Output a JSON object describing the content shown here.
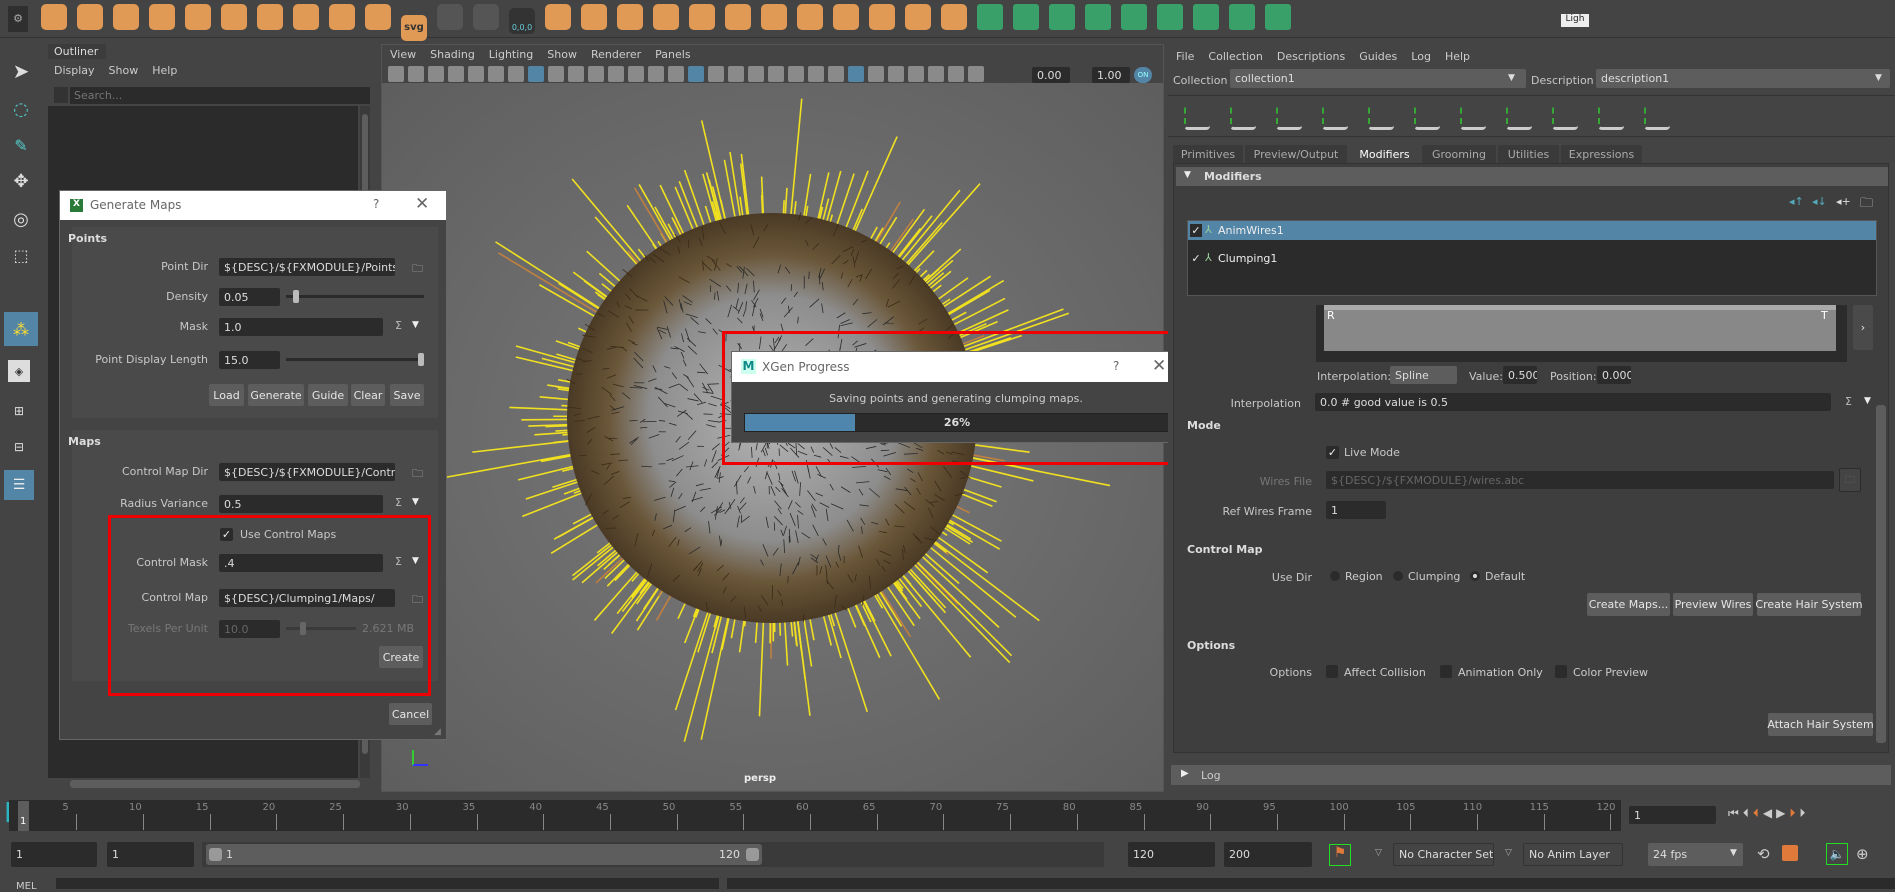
{
  "shelf": {
    "icons": [
      "poly-sphere-icon",
      "poly-cube-icon",
      "poly-cylinder-icon",
      "poly-cone-icon",
      "poly-torus-icon",
      "poly-plane-icon",
      "poly-disc-icon",
      "platonic-icon",
      "super-shape-icon",
      "type-icon",
      "svg-icon",
      "measure-icon",
      "locator-icon",
      "world-origin-icon",
      "sculpt-icon",
      "combine-icon",
      "separate-icon",
      "smooth-icon",
      "extrude-icon",
      "bridge-icon",
      "append-icon",
      "multi-cut-icon",
      "bevel-icon",
      "edge-loop-icon",
      "uv-icon",
      "mirror-icon",
      "xgen-create-icon",
      "xgen-guide-icon",
      "xgen-groom-icon",
      "xgen-collection-icon",
      "xgen-modifier-icon",
      "xgen-preview-icon",
      "xgen-map-icon",
      "xgen-export-icon",
      "xgen-tool-icon"
    ],
    "svg_label": "svg",
    "origin_label": "0,0,0",
    "light_tab": "Ligh"
  },
  "outliner": {
    "tab": "Outliner",
    "menu": [
      "Display",
      "Show",
      "Help"
    ],
    "search_placeholder": "Search..."
  },
  "viewport": {
    "menu": [
      "View",
      "Shading",
      "Lighting",
      "Show",
      "Renderer",
      "Panels"
    ],
    "exposure": "0.00",
    "gamma": "1.00",
    "color_mgmt": "ON",
    "camera_label": "persp"
  },
  "generate_maps": {
    "title": "Generate Maps",
    "help": "?",
    "points_header": "Points",
    "point_dir_label": "Point Dir",
    "point_dir": "${DESC}/${FXMODULE}/Points/",
    "density_label": "Density",
    "density": "0.05",
    "density_slider": 0.05,
    "mask_label": "Mask",
    "mask": "1.0",
    "pdl_label": "Point Display Length",
    "pdl": "15.0",
    "pdl_slider": 1.0,
    "buttons": [
      "Load",
      "Generate",
      "Guide",
      "Clear",
      "Save"
    ],
    "maps_header": "Maps",
    "control_map_dir_label": "Control Map Dir",
    "control_map_dir": "${DESC}/${FXMODULE}/Control/",
    "radius_variance_label": "Radius Variance",
    "radius_variance": "0.5",
    "use_control_maps": "Use Control Maps",
    "control_mask_label": "Control Mask",
    "control_mask": ".4",
    "control_map_label": "Control Map",
    "control_map": "${DESC}/Clumping1/Maps/",
    "texels_label": "Texels Per Unit",
    "texels": "10.0",
    "texels_size": "2.621 MB",
    "create": "Create",
    "cancel": "Cancel"
  },
  "progress": {
    "title": "XGen Progress",
    "help": "?",
    "message": "Saving points and generating clumping maps.",
    "percent": 26,
    "percent_label": "26%"
  },
  "xgen": {
    "menu": [
      "File",
      "Collection",
      "Descriptions",
      "Guides",
      "Log",
      "Help"
    ],
    "collection_label": "Collection",
    "collection": "collection1",
    "description_label": "Description",
    "description": "description1",
    "tabs": [
      "Primitives",
      "Preview/Output",
      "Modifiers",
      "Grooming",
      "Utilities",
      "Expressions"
    ],
    "active_tab": "Modifiers",
    "modifiers_header": "Modifiers",
    "modifiers": [
      {
        "name": "AnimWires1",
        "checked": true,
        "selected": true
      },
      {
        "name": "Clumping1",
        "checked": true,
        "selected": false
      }
    ],
    "ramp_root": "R",
    "ramp_tip": "T",
    "ramp_interp_label": "Interpolation:",
    "ramp_interp": "Spline",
    "value_label": "Value:",
    "value": "0.500",
    "position_label": "Position:",
    "position": "0.000",
    "interpolation_label": "Interpolation",
    "interpolation": "0.0 # good value is 0.5",
    "mode_header": "Mode",
    "live_mode": "Live Mode",
    "wires_file_label": "Wires File",
    "wires_file": "${DESC}/${FXMODULE}/wires.abc",
    "ref_frame_label": "Ref Wires Frame",
    "ref_frame": "1",
    "control_map_header": "Control Map",
    "use_dir_label": "Use Dir",
    "use_dir_options": [
      "Region",
      "Clumping",
      "Default"
    ],
    "use_dir_selected": "Default",
    "create_maps": "Create Maps...",
    "preview_wires": "Preview Wires",
    "create_hair_system": "Create Hair System",
    "options_header": "Options",
    "options_label": "Options",
    "options": [
      "Affect Collision",
      "Animation Only",
      "Color Preview"
    ],
    "attach_hair_system": "Attach Hair System",
    "log": "Log"
  },
  "timeline": {
    "ticks": [
      5,
      10,
      15,
      20,
      25,
      30,
      35,
      40,
      45,
      50,
      55,
      60,
      65,
      70,
      75,
      80,
      85,
      90,
      95,
      100,
      105,
      110,
      115,
      120
    ],
    "current": "1",
    "current_field": "1",
    "start_min": "1",
    "start": "1",
    "range_start": "1",
    "range_end": "120",
    "end": "120",
    "end_max": "200",
    "character_set": "No Character Set",
    "anim_layer": "No Anim Layer",
    "fps": "24 fps",
    "mel": "MEL"
  },
  "colors": {
    "accent": "#5285a6",
    "progress": "#4f86ad",
    "shelf": "#e09a55",
    "highlight": "#ee0000"
  }
}
